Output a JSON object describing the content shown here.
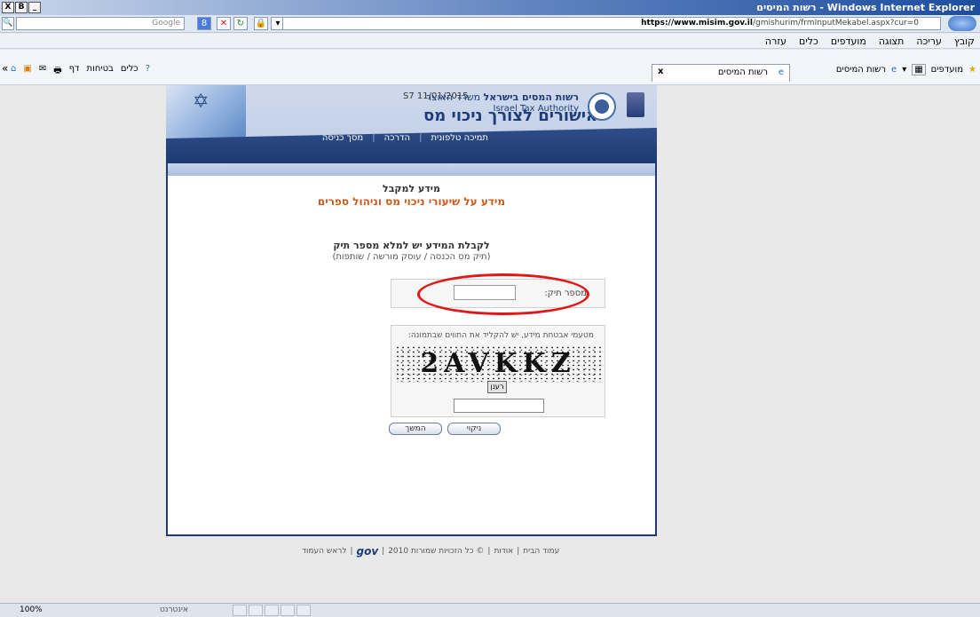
{
  "browser": {
    "window_title": "רשות המיסים - Windows Internet Explorer",
    "window_buttons": [
      "X",
      "B",
      "_"
    ],
    "search_brand": "Google",
    "url_prefix": "https://www.",
    "url_host": "misim.gov.il",
    "url_path": "/gmishurim/frmInputMekabel.aspx?cur=0",
    "menu": [
      "קובץ",
      "עריכה",
      "תצוגה",
      "מועדפים",
      "כלים",
      "עזרה"
    ],
    "favorites_label": "מועדפים",
    "fav_site_label": "רשות המיסים",
    "active_tab_label": "רשות המיסים",
    "tab_close": "x",
    "command_items": [
      "דף",
      "בטיחות",
      "כלים"
    ],
    "chevron": "«"
  },
  "header": {
    "date": "S7 11/01/2015",
    "main_title": "אישורים לצורך ניכוי מס",
    "org_name_bold": "רשות המסים בישראל",
    "org_ministry": "משרד האוצר",
    "org_name_en": "Israel Tax Authority"
  },
  "nav": {
    "items": [
      "מסך כניסה",
      "הדרכה",
      "תמיכה טלפונית"
    ],
    "separator": "|"
  },
  "content": {
    "heading_1": "מידע למקבל",
    "heading_2": "מידע על שיעורי ניכוי מס וניהול ספרים",
    "instruction_1": "לקבלת המידע יש למלא מספר תיק",
    "instruction_2": "(תיק מס הכנסה / עוסק מורשה / שותפות)",
    "file_number_label": "מספר תיק:",
    "file_number_value": "",
    "captcha_label": "מטעמי אבטחת מידע, יש להקליד את התווים שבתמונה:",
    "captcha_text": "2AVKKZ",
    "refresh_label": "רענן",
    "captcha_value": "",
    "clear_button": "ניקוי",
    "continue_button": "המשך"
  },
  "footer": {
    "home": "עמוד הבית",
    "about": "אודות",
    "copyright": "© כל הזכויות שמורות 2010",
    "gov": "gov",
    "top": "לראש העמוד"
  },
  "status": {
    "zoom": "100%",
    "text": "אינטרנט"
  },
  "colors": {
    "navy": "#1f3a70",
    "accent_orange": "#cc5a1a",
    "highlight_red": "#e01818"
  }
}
